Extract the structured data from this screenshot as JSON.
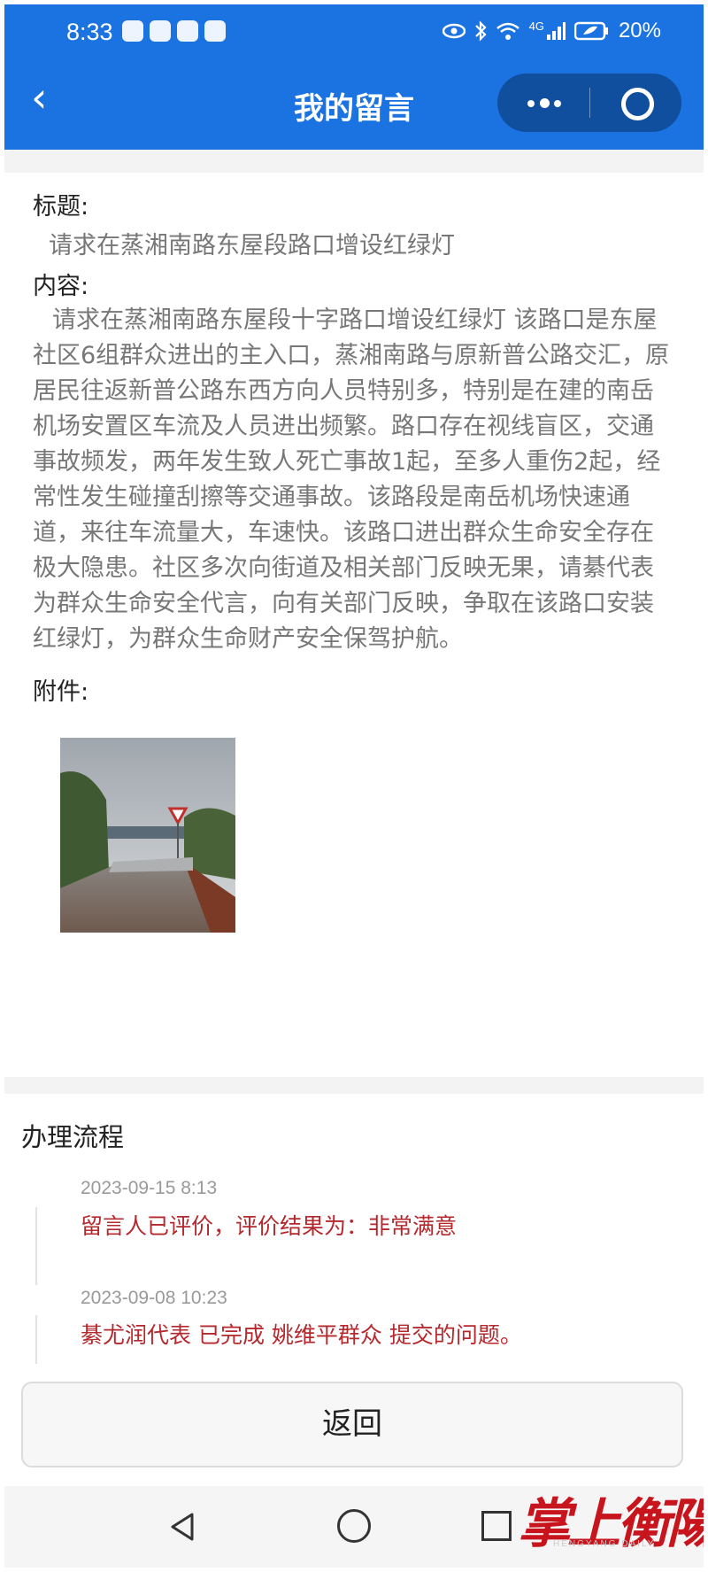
{
  "status_bar": {
    "time": "8:33",
    "network": "4G",
    "battery": "20%"
  },
  "nav": {
    "title": "我的留言"
  },
  "message": {
    "title_label": "标题:",
    "title_value": "请求在蒸湘南路东屋段路口增设红绿灯",
    "content_label": "内容:",
    "content_value": "请求在蒸湘南路东屋段十字路口增设红绿灯 该路口是东屋社区6组群众进出的主入口，蒸湘南路与原新普公路交汇，原居民往返新普公路东西方向人员特别多，特别是在建的南岳机场安置区车流及人员进出频繁。路口存在视线盲区，交通事故频发，两年发生致人死亡事故1起，至多人重伤2起，经常性发生碰撞刮擦等交通事故。该路段是南岳机场快速通道，来往车流量大，车速快。该路口进出群众生命安全存在极大隐患。社区多次向街道及相关部门反映无果，请綦代表为群众生命安全代言，向有关部门反映，争取在该路口安装红绿灯，为群众生命财产安全保驾护航。",
    "attachment_label": "附件:"
  },
  "process": {
    "title": "办理流程",
    "steps": [
      {
        "time": "2023-09-15 8:13",
        "text": "留言人已评价，评价结果为：非常满意"
      },
      {
        "time": "2023-09-08 10:23",
        "text": "綦尤润代表 已完成 姚维平群众 提交的问题。"
      }
    ]
  },
  "footer": {
    "back_button": "返回"
  },
  "watermark": {
    "text": "掌上衡陽",
    "sub": "HENGYANG DAILY"
  },
  "colors": {
    "primary": "#1a73e0",
    "capsule": "#0f4f9e",
    "process_text": "#b4292e",
    "watermark": "#c8141c"
  }
}
